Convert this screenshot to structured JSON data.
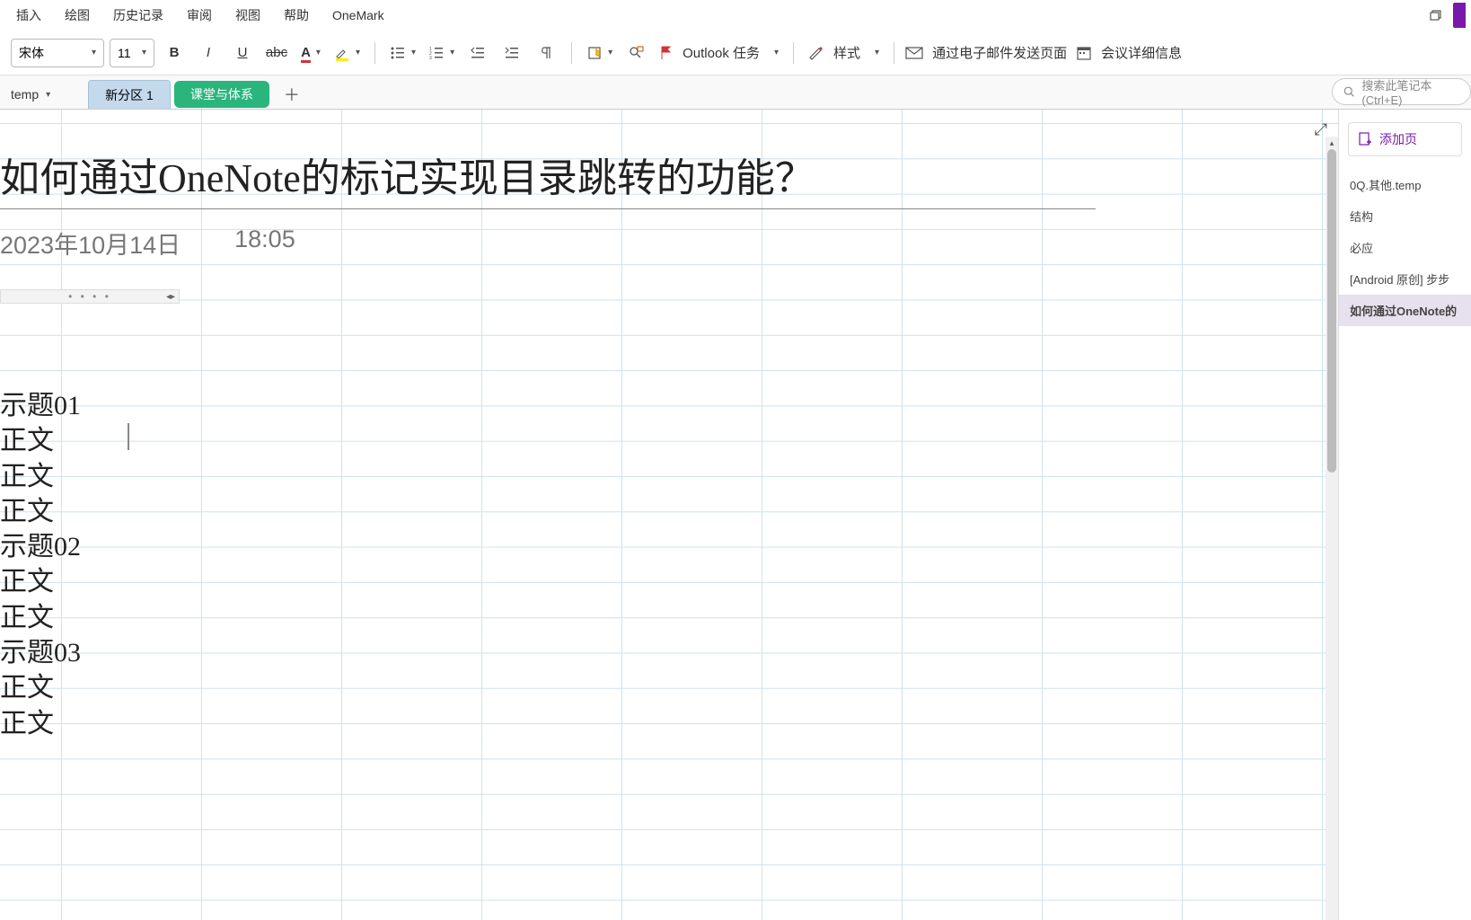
{
  "menu": {
    "items": [
      "插入",
      "绘图",
      "历史记录",
      "审阅",
      "视图",
      "帮助",
      "OneMark"
    ]
  },
  "toolbar": {
    "font_name": "宋体",
    "font_size": "11",
    "outlook_label": "Outlook 任务",
    "style_label": "样式",
    "email_label": "通过电子邮件发送页面",
    "meeting_label": "会议详细信息"
  },
  "tabs": {
    "notebook": "temp",
    "items": [
      {
        "label": "新分区 1",
        "type": "active"
      },
      {
        "label": "课堂与体系",
        "type": "green"
      }
    ],
    "search_placeholder": "搜索此笔记本(Ctrl+E)"
  },
  "page": {
    "title": "如何通过OneNote的标记实现目录跳转的功能？",
    "date": "2023年10月14日",
    "time": "18:05",
    "body": [
      "示题01",
      "正文",
      "正文",
      "正文",
      "示题02",
      "正文",
      "正文",
      "示题03",
      "正文",
      "正文"
    ]
  },
  "sidebar": {
    "add_page": "添加页",
    "pages": [
      "0Q.其他.temp",
      "结构",
      "必应",
      "[Android 原创] 步步",
      "如何通过OneNote的"
    ]
  }
}
